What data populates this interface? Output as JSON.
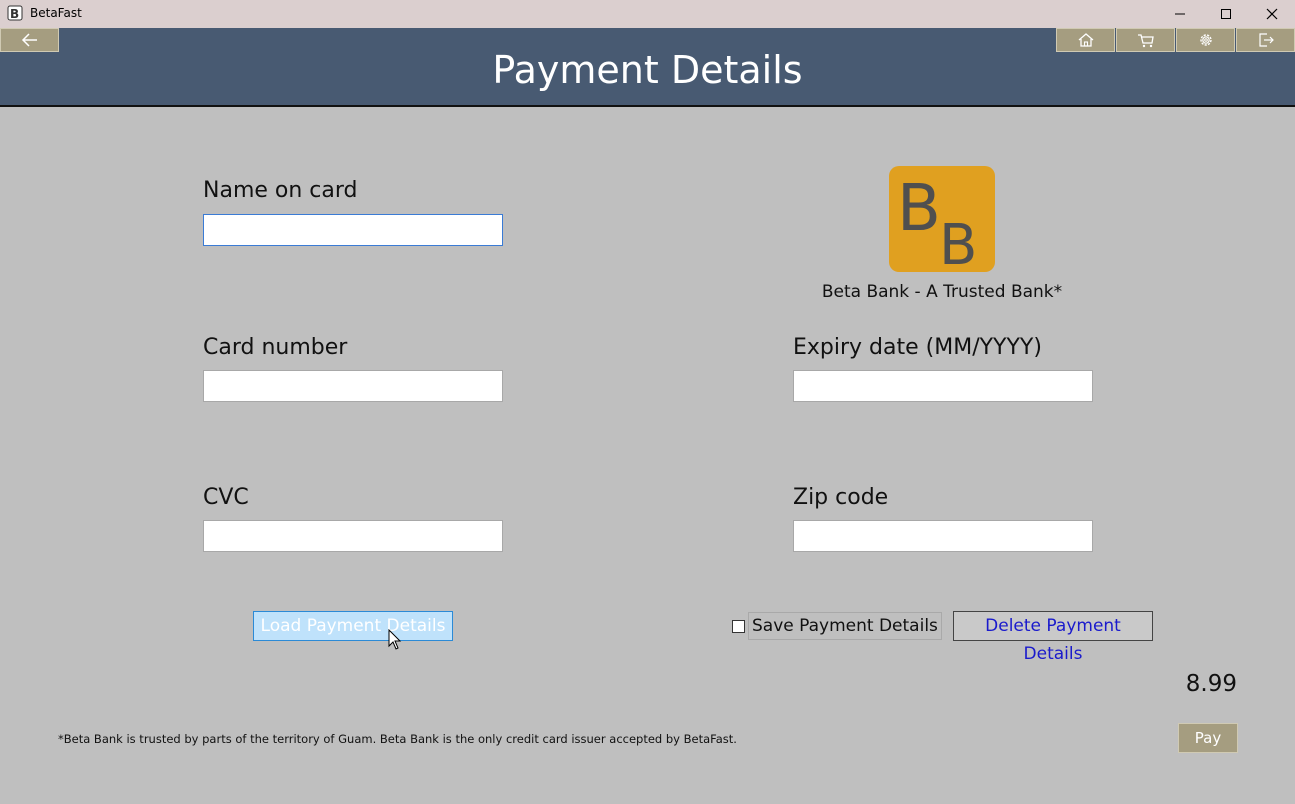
{
  "window": {
    "app_title": "BetaFast",
    "app_icon_letter": "B",
    "controls": [
      "minimize-icon",
      "maximize-icon",
      "close-icon"
    ]
  },
  "header": {
    "title": "Payment Details",
    "back_icon": "arrow-left-icon",
    "nav_icons": [
      "home-icon",
      "cart-icon",
      "gear-icon",
      "sign-out-icon"
    ],
    "header_color": "#485a72",
    "nav_button_color": "#a59d80"
  },
  "form": {
    "name_label": "Name on card",
    "name_value": "",
    "card_number_label": "Card number",
    "card_number_value": "",
    "expiry_label": "Expiry date (MM/YYYY)",
    "expiry_value": "",
    "cvc_label": "CVC",
    "cvc_value": "",
    "zip_label": "Zip code",
    "zip_value": ""
  },
  "bank": {
    "logo_text": "BB",
    "logo_color": "#e0a020",
    "caption": "Beta Bank - A Trusted Bank*"
  },
  "actions": {
    "load_label": "Load Payment Details",
    "save_label": "Save Payment Details",
    "save_checked": false,
    "delete_label": "Delete Payment Details",
    "pay_label": "Pay"
  },
  "total": "8.99",
  "footnote": "*Beta Bank is trusted by parts of the territory of Guam. Beta Bank is the only credit card issuer accepted by BetaFast."
}
